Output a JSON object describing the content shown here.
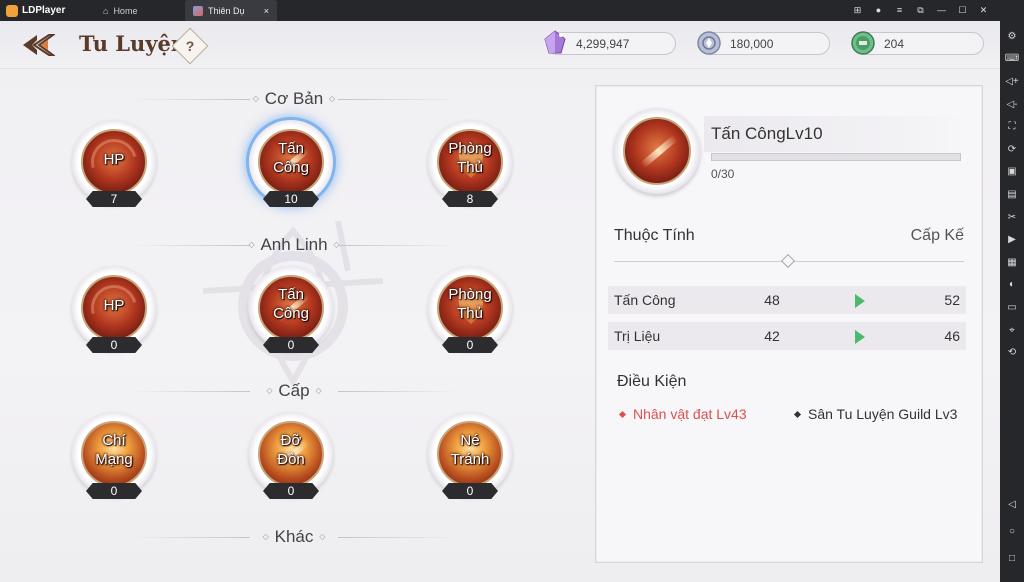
{
  "emulator": {
    "brand": "LDPlayer",
    "tabs": [
      {
        "label": "Home"
      },
      {
        "label": "Thiên Dụ"
      }
    ],
    "tab_close": "×",
    "window_controls": [
      "gamepad-icon",
      "account-icon",
      "menu-icon",
      "restore-icon",
      "minimize-icon",
      "maximize-icon",
      "close-icon"
    ],
    "sidebar_tools": [
      "settings-icon",
      "keyboard-icon",
      "volume-up-icon",
      "volume-down-icon",
      "resolution-icon",
      "sync-icon",
      "install-apk-icon",
      "macro-icon",
      "cut-icon",
      "record-icon",
      "operation-icon",
      "shake-icon",
      "folder-icon",
      "location-icon",
      "rotate-icon"
    ],
    "sidebar_nav": [
      "back-icon",
      "home-icon",
      "recent-apps-icon"
    ]
  },
  "header": {
    "title": "Tu Luyện",
    "help_label": "?",
    "resources": [
      {
        "name": "crystal",
        "value": "4,299,947",
        "color": "#a57ad6"
      },
      {
        "name": "silver",
        "value": "180,000",
        "color": "#8e98b8"
      },
      {
        "name": "guild",
        "value": "204",
        "color": "#4f9a6a"
      }
    ]
  },
  "sections": [
    {
      "title": "Cơ Bản",
      "skills": [
        {
          "label": "HP",
          "level": "7"
        },
        {
          "label": "Tấn\nCông",
          "level": "10"
        },
        {
          "label": "Phòng\nThủ",
          "level": "8"
        }
      ]
    },
    {
      "title": "Anh Linh",
      "skills": [
        {
          "label": "HP",
          "level": "0"
        },
        {
          "label": "Tấn\nCông",
          "level": "0"
        },
        {
          "label": "Phòng\nThủ",
          "level": "0"
        }
      ]
    },
    {
      "title": "Cấp",
      "skills": [
        {
          "label": "Chí\nMạng",
          "level": "0"
        },
        {
          "label": "Đỡ\nĐòn",
          "level": "0"
        },
        {
          "label": "Né\nTránh",
          "level": "0"
        }
      ]
    },
    {
      "title": "Khác",
      "skills": []
    }
  ],
  "detail": {
    "skill_name": "Tấn CôngLv10",
    "progress_text": "0/30",
    "progress_fraction": 0,
    "attr_header": "Thuộc Tính",
    "next_header": "Cấp Kế",
    "stats": [
      {
        "name": "Tấn Công",
        "current": "48",
        "next": "52"
      },
      {
        "name": "Trị Liệu",
        "current": "42",
        "next": "46"
      }
    ],
    "conditions_header": "Điều Kiện",
    "conditions": [
      {
        "text": "Nhân vật đạt Lv43",
        "status": "unmet",
        "color": "#d9534f"
      },
      {
        "text": "Sân Tu Luyện Guild Lv3",
        "status": "met",
        "color": "#333333"
      }
    ]
  }
}
